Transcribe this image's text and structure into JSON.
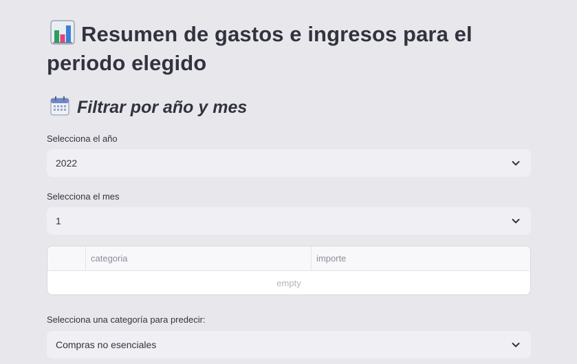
{
  "header": {
    "title": "Resumen de gastos e ingresos para el periodo elegido",
    "title_icon": "bar-chart-icon"
  },
  "filters": {
    "subtitle": "Filtrar por año y mes",
    "subtitle_icon": "calendar-icon",
    "year": {
      "label": "Selecciona el año",
      "value": "2022"
    },
    "month": {
      "label": "Selecciona el mes",
      "value": "1"
    }
  },
  "table": {
    "columns": [
      "",
      "categoria",
      "importe"
    ],
    "empty_text": "empty"
  },
  "predict": {
    "label": "Selecciona una categoría para predecir:",
    "value": "Compras no esenciales"
  },
  "colors": {
    "background": "#e8e8ec",
    "input_bg": "#f0f0f4",
    "text": "#31333f"
  }
}
